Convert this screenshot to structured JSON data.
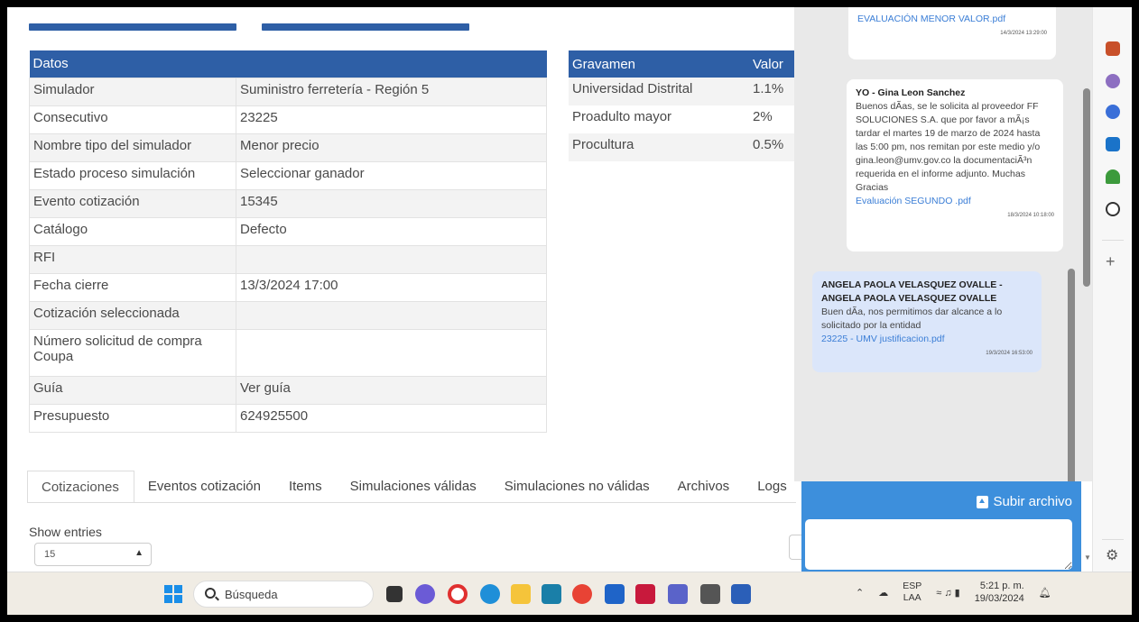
{
  "datos_table": {
    "header": "Datos",
    "rows": [
      {
        "label": "Simulador",
        "value": "Suministro ferretería - Región 5"
      },
      {
        "label": "Consecutivo",
        "value": "23225"
      },
      {
        "label": "Nombre tipo del simulador",
        "value": "Menor precio"
      },
      {
        "label": "Estado proceso simulación",
        "value": "Seleccionar ganador"
      },
      {
        "label": "Evento cotización",
        "value": "15345"
      },
      {
        "label": "Catálogo",
        "value": "Defecto"
      },
      {
        "label": "RFI",
        "value": ""
      },
      {
        "label": "Fecha cierre",
        "value": "13/3/2024 17:00"
      },
      {
        "label": "Cotización seleccionada",
        "value": ""
      },
      {
        "label": "Número solicitud de compra Coupa",
        "value": ""
      },
      {
        "label": "Guía",
        "value": "Ver guía"
      },
      {
        "label": "Presupuesto",
        "value": "624925500"
      }
    ]
  },
  "gravamen_table": {
    "headers": [
      "Gravamen",
      "Valor"
    ],
    "rows": [
      {
        "name": "Universidad Distrital",
        "value": "1.1%"
      },
      {
        "name": "Proadulto mayor",
        "value": "2%"
      },
      {
        "name": "Procultura",
        "value": "0.5%"
      }
    ]
  },
  "tabs": [
    "Cotizaciones",
    "Eventos cotización",
    "Items",
    "Simulaciones válidas",
    "Simulaciones no válidas",
    "Archivos",
    "Logs"
  ],
  "active_tab": "Cotizaciones",
  "entries": {
    "label": "Show entries",
    "selected": "15"
  },
  "chat": {
    "messages": [
      {
        "sender": "",
        "text": "",
        "attachment": "EVALUACIÓN MENOR VALOR.pdf",
        "timestamp": "14/3/2024 13:29:00"
      },
      {
        "sender": "YO - Gina Leon Sanchez",
        "text": "Buenos dÃas, se le solicita al proveedor FF SOLUCIONES S.A. que por favor a mÃ¡s tardar el martes 19 de marzo de 2024 hasta las 5:00 pm, nos remitan por este medio y/o gina.leon@umv.gov.co la documentaciÃ³n requerida en el informe adjunto. Muchas Gracias",
        "attachment": "Evaluación SEGUNDO .pdf",
        "timestamp": "18/3/2024 10:18:00"
      },
      {
        "sender": "ANGELA PAOLA VELASQUEZ OVALLE - ANGELA PAOLA VELASQUEZ OVALLE",
        "text": "Buen dÃa, nos permitimos dar alcance a lo solicitado por la entidad",
        "attachment": "23225 - UMV justificacion.pdf",
        "timestamp": "19/3/2024 16:53:00"
      }
    ],
    "upload_label": "Subir archivo"
  },
  "taskbar": {
    "search_placeholder": "Búsqueda",
    "lang_top": "ESP",
    "lang_bottom": "LAA",
    "time": "5:21 p. m.",
    "date": "19/03/2024"
  },
  "colors": {
    "header_blue": "#2e5fa6",
    "upload_blue": "#3d8fdc",
    "link_blue": "#3b7ed6",
    "mine_bubble": "#dbe6fa"
  }
}
